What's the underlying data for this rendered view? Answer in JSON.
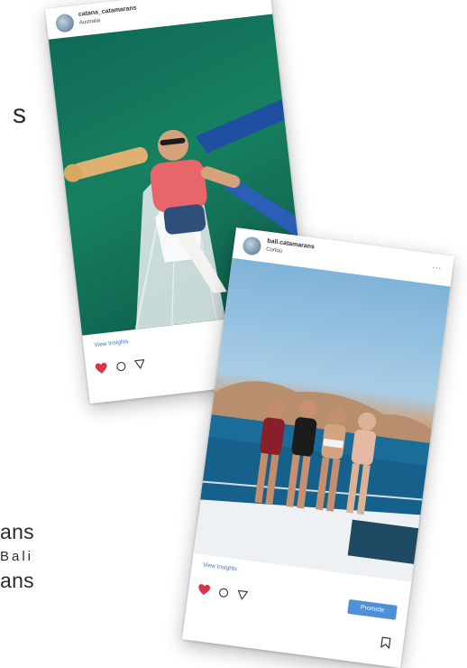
{
  "background_text": {
    "s": "s",
    "line1": "ans",
    "line2": "Bali",
    "line3": "ans"
  },
  "posts": [
    {
      "username": "catana_catamarans",
      "location": "Australia",
      "more": "...",
      "insights_label": "View Insights",
      "liked": true,
      "icons": [
        "heart-icon",
        "comment-icon",
        "share-icon"
      ]
    },
    {
      "username": "bali.catamarans",
      "location": "Corfou",
      "more": "...",
      "insights_label": "View Insights",
      "promote_label": "Promote",
      "liked": true,
      "icons": [
        "heart-icon",
        "comment-icon",
        "share-icon",
        "bookmark-icon"
      ]
    }
  ],
  "colors": {
    "like": "#d9344a",
    "link": "#3b78c4",
    "promote": "#4f8fd6"
  }
}
